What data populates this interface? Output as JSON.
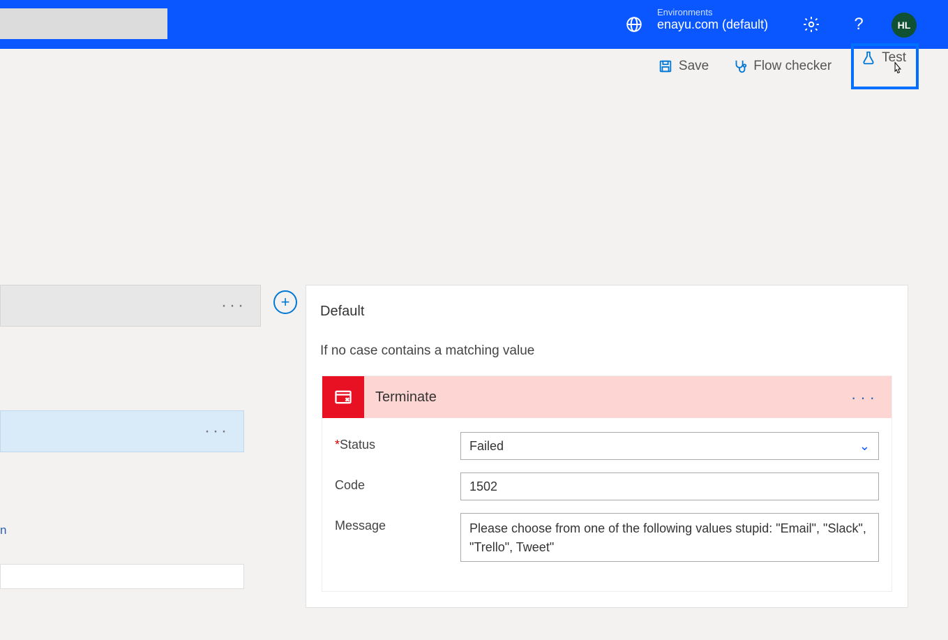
{
  "header": {
    "environments_label": "Environments",
    "environment_name": "enayu.com (default)",
    "avatar_initials": "HL"
  },
  "toolbar": {
    "save": "Save",
    "flow_checker": "Flow checker",
    "test": "Test"
  },
  "left": {
    "link_fragment": "n"
  },
  "default_card": {
    "title": "Default",
    "subtitle": "If no case contains a matching value",
    "terminate": {
      "title": "Terminate",
      "fields": {
        "status_label": "Status",
        "status_value": "Failed",
        "code_label": "Code",
        "code_value": "1502",
        "message_label": "Message",
        "message_value": "Please choose from one of the following values stupid: \"Email\", \"Slack\", \"Trello\", Tweet\""
      }
    }
  }
}
